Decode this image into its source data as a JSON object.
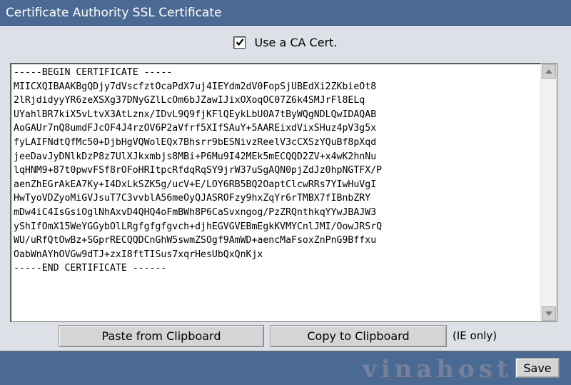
{
  "window": {
    "title": "Certificate Authority SSL Certificate"
  },
  "ca_option": {
    "label": "Use a CA Cert.",
    "checked": true
  },
  "certificate": {
    "lines": [
      "-----BEGIN CERTIFICATE -----",
      "MIICXQIBAAKBgQDjy7dVscfztOcaPdX7uj4IEYdm2dV0FopSjUBEdXi2ZKbieOt8",
      "2lRjdidyyYR6zeXSXg37DNyGZlLcOm6bJZawIJixOXoqOC07Z6k4SMJrFl8ELq",
      "UYahlBR7kiX5vLtvX3AtLznx/IDvL9Q9fjKFlQEykLbU0A7tByWQgNDLQwIDAQAB",
      "AoGAUr7nQ8umdFJcOF4J4rzOV6P2aVfrf5XIfSAuY+5AAREixdVixSHuz4pV3g5x",
      "fyLAIFNdtQfMc50+DjbHgVQWolEQx7Bhsrr9bESNivzReelV3cCXSzYQuBf8pXqd",
      "jeeDavJyDNlkDzP8z7UlXJkxmbjs8MBi+P6Mu9I42MEk5mECQQD2ZV+x4wK2hnNu",
      "lqHNM9+87t0pwvFSf8rOFoHRItpcRfdqRqSY9jrW37uSgAQN0pjZdJz0hpNGTFX/P",
      "aenZhEGrAkEA7Ky+I4DxLkSZK5g/ucV+E/LOY6RB5BQ2OaptClcwRRs7YIwHuVgI",
      "HwTyoVDZyoMiGVJsuT7C3vvblA56meOyQJASROFzy9hxZqYr6rTMBX7fIBnbZRY",
      "mDw4iC4IsGsiOglNhAxvD4QHQ4oFmBWh8P6CaSvxngog/PzZRQnthkqYYwJBAJW3",
      "yShIfOmX15WeYGGybOlLRgfgfgfgvch+djhEGVGVEBmEgkKVMYCnlJMI/OowJRSrQ",
      "WU/uRfQtOwBz+SGprRECQQDCnGhW5swmZSOgf9AmWD+aencMaFsoxZnPnG9Bffxu",
      "OabWnAYhOVGw9dTJ+zxI8ftTISus7xqrHesUbQxQnKjx",
      "-----END CERTIFICATE ------"
    ]
  },
  "buttons": {
    "paste": "Paste from Clipboard",
    "copy": "Copy to Clipboard",
    "ie_note": "(IE only)",
    "save": "Save"
  },
  "footer": {
    "watermark": "vinahost"
  },
  "colors": {
    "header_bg": "#4a6a94",
    "panel_bg": "#dde0e6",
    "button_bg": "#d5d5d5"
  },
  "icons": {
    "checkbox": "checkmark-icon",
    "scroll_up": "triangle-up-icon",
    "scroll_down": "triangle-down-icon"
  }
}
